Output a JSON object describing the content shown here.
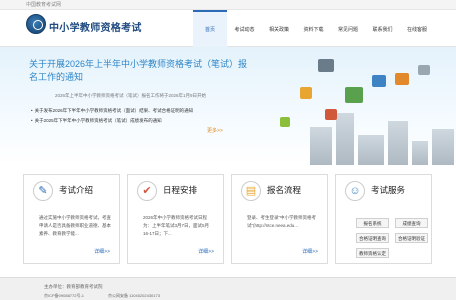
{
  "topbar": {
    "text": "中国教育考试网"
  },
  "header": {
    "title": "中小学教师资格考试",
    "nav": [
      "首页",
      "考试动态",
      "相关政策",
      "资料下载",
      "常见问题",
      "联系我们",
      "在线客服"
    ]
  },
  "banner": {
    "title": "关于开展2026年上半年中小学教师资格考试（笔试）报名工作的通知",
    "subtitle": "2026年上半年中小学教师资格考试（笔试）报名工作将于2026年1月9日开始",
    "news": [
      "关于发布2026年下半年中小学教师资格考试（面试）结果、考试合格证明的通知",
      "关于2025年下半年中小学教师资格考试（笔试）成绩发布的通知"
    ],
    "more": "更多>>"
  },
  "cards": [
    {
      "title": "考试介绍",
      "body": "通过实施中小学教师资格考试，考查申请人是否具备教师职业道德、基本素养、教育教学能...",
      "more": "详细>>"
    },
    {
      "title": "日程安排",
      "body": "2026年中小学教师资格考试日程为：上半年笔试3月7日，面试5月16-17日；下...",
      "more": "详细>>"
    },
    {
      "title": "报名流程",
      "body": "登录、考生登录“中小学教师资格考试”(http://ntce.neea.edu...",
      "more": "详细>>"
    },
    {
      "title": "考试服务",
      "buttons": [
        "报名系统",
        "成绩查询",
        "合格证明查询",
        "合格证明验证",
        "教师资格认定"
      ]
    }
  ],
  "footer": {
    "line1": "主办单位：教育部教育考试院",
    "line2": "京ICP备09088772号-1",
    "line3": "京公网安备 11040202430173"
  },
  "colors": {
    "accent": "#2a6ab8",
    "brand": "#1f4a80",
    "orange": "#e08a1e"
  }
}
